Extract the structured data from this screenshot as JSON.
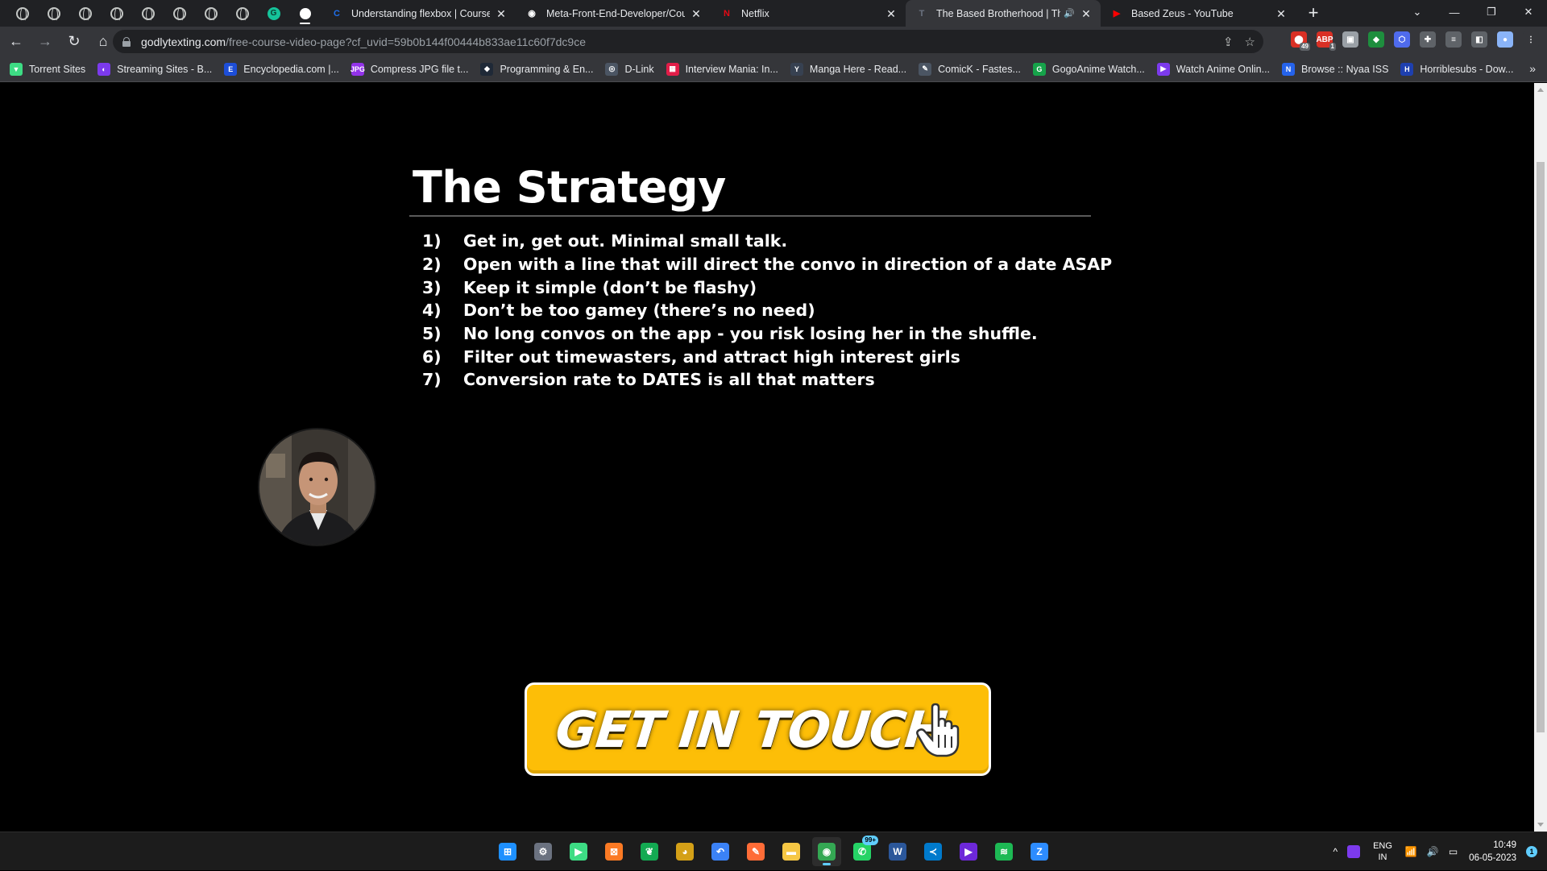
{
  "browser": {
    "pinned_tabs": [
      {
        "icon": "globe-icon"
      },
      {
        "icon": "globe-icon"
      },
      {
        "icon": "globe-icon"
      },
      {
        "icon": "globe-icon"
      },
      {
        "icon": "globe-icon"
      },
      {
        "icon": "globe-icon"
      },
      {
        "icon": "globe-icon"
      },
      {
        "icon": "globe-icon"
      },
      {
        "icon": "grammarly-icon",
        "glyph": "G"
      },
      {
        "icon": "white-dot-icon"
      }
    ],
    "tabs": [
      {
        "title": "Understanding flexbox | Coursera",
        "icon": "coursera-icon",
        "glyph": "C",
        "color": "#1f6feb"
      },
      {
        "title": "Meta-Front-End-Developer/Cou",
        "icon": "github-icon",
        "glyph": "◉",
        "color": "#ffffff"
      },
      {
        "title": "Netflix",
        "icon": "netflix-icon",
        "glyph": "N",
        "color": "#e50914"
      },
      {
        "title": "The Based Brotherhood | The",
        "icon": "site-icon",
        "glyph": "T",
        "color": "#6b7280",
        "selected": true,
        "audio": "🔊"
      },
      {
        "title": "Based Zeus - YouTube",
        "icon": "youtube-icon",
        "glyph": "▶",
        "color": "#ff0000"
      }
    ],
    "close_glyph": "✕",
    "new_tab_glyph": "+",
    "window_controls": {
      "dropdown": "⌄",
      "minimize": "—",
      "restore": "❐",
      "close": "✕"
    },
    "nav": {
      "back": "←",
      "forward": "→",
      "reload": "↻",
      "home": "⌂"
    },
    "url": {
      "host": "godlytexting.com",
      "path": "/free-course-video-page?cf_uvid=59b0b144f00444b833ae11c60f7dc9ce"
    },
    "omnibox_actions": {
      "share": "⇪",
      "star": "☆"
    },
    "extensions": [
      {
        "icon": "extension-red-icon",
        "glyph": "⬤",
        "color": "#d93025",
        "badge": "49"
      },
      {
        "icon": "adblock-icon",
        "glyph": "ABP",
        "color": "#d93025",
        "badge": "1"
      },
      {
        "icon": "extension-gray-icon",
        "glyph": "▣",
        "color": "#9aa0a6"
      },
      {
        "icon": "extension-green-icon",
        "glyph": "◆",
        "color": "#1e8e3e"
      },
      {
        "icon": "extension-blue-icon",
        "glyph": "⬡",
        "color": "#4f6bed"
      },
      {
        "icon": "puzzle-icon",
        "glyph": "✚",
        "color": "#5f6368"
      },
      {
        "icon": "reading-list-icon",
        "glyph": "≡",
        "color": "#5f6368"
      },
      {
        "icon": "side-panel-icon",
        "glyph": "◧",
        "color": "#5f6368"
      },
      {
        "icon": "profile-avatar-icon",
        "glyph": "●",
        "color": "#8ab4f8"
      },
      {
        "icon": "menu-dots-icon",
        "glyph": "⋮",
        "color": "#35363a"
      }
    ],
    "bookmarks": [
      {
        "label": "Torrent Sites",
        "icon": "shield-icon",
        "glyph": "▼",
        "color": "#3ddc84"
      },
      {
        "label": "Streaming Sites - B...",
        "icon": "streaming-icon",
        "glyph": "◐",
        "color": "#7c3aed"
      },
      {
        "label": "Encyclopedia.com |...",
        "icon": "encyclopedia-icon",
        "glyph": "E",
        "color": "#1d4ed8"
      },
      {
        "label": "Compress JPG file t...",
        "icon": "jpg-icon",
        "glyph": "JPG",
        "color": "#9333ea"
      },
      {
        "label": "Programming & En...",
        "icon": "programming-icon",
        "glyph": "◆",
        "color": "#1f2937"
      },
      {
        "label": "D-Link",
        "icon": "dlink-icon",
        "glyph": "◎",
        "color": "#4b5563"
      },
      {
        "label": "Interview Mania: In...",
        "icon": "interview-icon",
        "glyph": "▦",
        "color": "#e11d48"
      },
      {
        "label": "Manga Here - Read...",
        "icon": "manga-icon",
        "glyph": "Y",
        "color": "#374151"
      },
      {
        "label": "ComicK - Fastes...",
        "icon": "comick-icon",
        "glyph": "✎",
        "color": "#4b5563"
      },
      {
        "label": "GogoAnime Watch...",
        "icon": "gogoanime-icon",
        "glyph": "G",
        "color": "#16a34a"
      },
      {
        "label": "Watch Anime Onlin...",
        "icon": "anime-icon",
        "glyph": "▶",
        "color": "#7c3aed"
      },
      {
        "label": "Browse :: Nyaa ISS",
        "icon": "nyaa-icon",
        "glyph": "N",
        "color": "#2563eb"
      },
      {
        "label": "Horriblesubs - Dow...",
        "icon": "horriblesubs-icon",
        "glyph": "H",
        "color": "#1e40af"
      }
    ],
    "bookmarks_more": "»"
  },
  "slide": {
    "title": "The Strategy",
    "items": [
      {
        "num": "1)",
        "text": "Get in, get out. Minimal small talk."
      },
      {
        "num": "2)",
        "text": "Open with a line that will direct the convo in direction of a date ASAP"
      },
      {
        "num": "3)",
        "text": "Keep it simple (don’t be flashy)"
      },
      {
        "num": "4)",
        "text": "Don’t be too gamey (there’s no need)"
      },
      {
        "num": "5)",
        "text": "No long convos on the app - you risk losing her in the shuffle."
      },
      {
        "num": "6)",
        "text": "Filter out timewasters, and attract high interest girls"
      },
      {
        "num": "7)",
        "text": "Conversion rate to DATES is all that matters"
      }
    ]
  },
  "cta": {
    "label": "GET IN TOUCH",
    "color": "#fdbe07"
  },
  "taskbar": {
    "apps": [
      {
        "icon": "windows-start-icon",
        "glyph": "⊞",
        "color": "#1e90ff"
      },
      {
        "icon": "settings-gear-icon",
        "glyph": "⚙",
        "color": "#6b7280"
      },
      {
        "icon": "android-studio-icon",
        "glyph": "▶",
        "color": "#3ddc84"
      },
      {
        "icon": "xampp-icon",
        "glyph": "⊠",
        "color": "#fb7a24"
      },
      {
        "icon": "mongodb-icon",
        "glyph": "❦",
        "color": "#13aa52"
      },
      {
        "icon": "dbeaver-icon",
        "glyph": "◕",
        "color": "#d4a017"
      },
      {
        "icon": "arrow-app-icon",
        "glyph": "↶",
        "color": "#3b82f6"
      },
      {
        "icon": "postman-icon",
        "glyph": "✎",
        "color": "#ff6c37"
      },
      {
        "icon": "file-explorer-icon",
        "glyph": "▬",
        "color": "#f6c744"
      },
      {
        "icon": "chrome-icon",
        "glyph": "◉",
        "color": "#34a853",
        "active": true
      },
      {
        "icon": "whatsapp-icon",
        "glyph": "✆",
        "color": "#25d366",
        "badge": "99+"
      },
      {
        "icon": "word-icon",
        "glyph": "W",
        "color": "#2b579a"
      },
      {
        "icon": "vscode-icon",
        "glyph": "≺",
        "color": "#007acc"
      },
      {
        "icon": "media-player-icon",
        "glyph": "▶",
        "color": "#6d28d9"
      },
      {
        "icon": "spotify-icon",
        "glyph": "≋",
        "color": "#1db954"
      },
      {
        "icon": "zoom-icon",
        "glyph": "Z",
        "color": "#2d8cff"
      }
    ],
    "tray": {
      "chevron": "^",
      "lang_line1": "ENG",
      "lang_line2": "IN",
      "wifi": "📶",
      "volume": "🔊",
      "battery": "▭",
      "time": "10:49",
      "date": "06-05-2023",
      "notifications": "1"
    }
  }
}
